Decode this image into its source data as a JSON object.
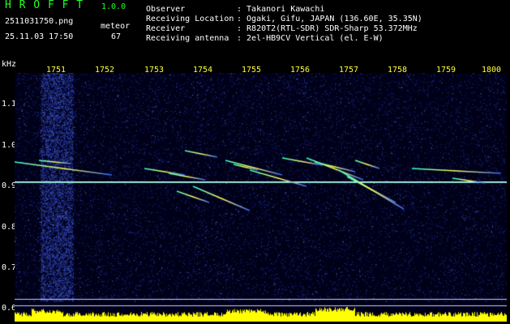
{
  "app": {
    "name": "H R O F F T",
    "version": "1.0.0"
  },
  "file": {
    "name": "2511031750.png",
    "datetime": "25.11.03 17:50"
  },
  "meteor": {
    "label": "meteor",
    "count": "67"
  },
  "info": [
    {
      "label": "Observer",
      "value": ": Takanori Kawachi"
    },
    {
      "label": "Receiving Location",
      "value": ": Ogaki, Gifu, JAPAN (136.60E, 35.35N)"
    },
    {
      "label": "Receiver",
      "value": ": R820T2(RTL-SDR) SDR-Sharp 53.372MHz"
    },
    {
      "label": "Receiving antenna",
      "value": ": 2el-HB9CV Vertical (el. E-W)"
    }
  ],
  "axis": {
    "ylabel": "kHz",
    "xticks": [
      "1751",
      "1752",
      "1753",
      "1754",
      "1755",
      "1756",
      "1757",
      "1758",
      "1759",
      "1800"
    ],
    "yticks": [
      "1.1",
      "1.0",
      "0.9",
      "0.8",
      "0.7",
      "0.6"
    ]
  },
  "colors": {
    "background": "#000000",
    "noise": "#1a2a8a",
    "signal": "#ffff44",
    "level": "#ffff00",
    "text": "#ffffff",
    "title": "#22ff22",
    "axis": "#ffff33"
  }
}
